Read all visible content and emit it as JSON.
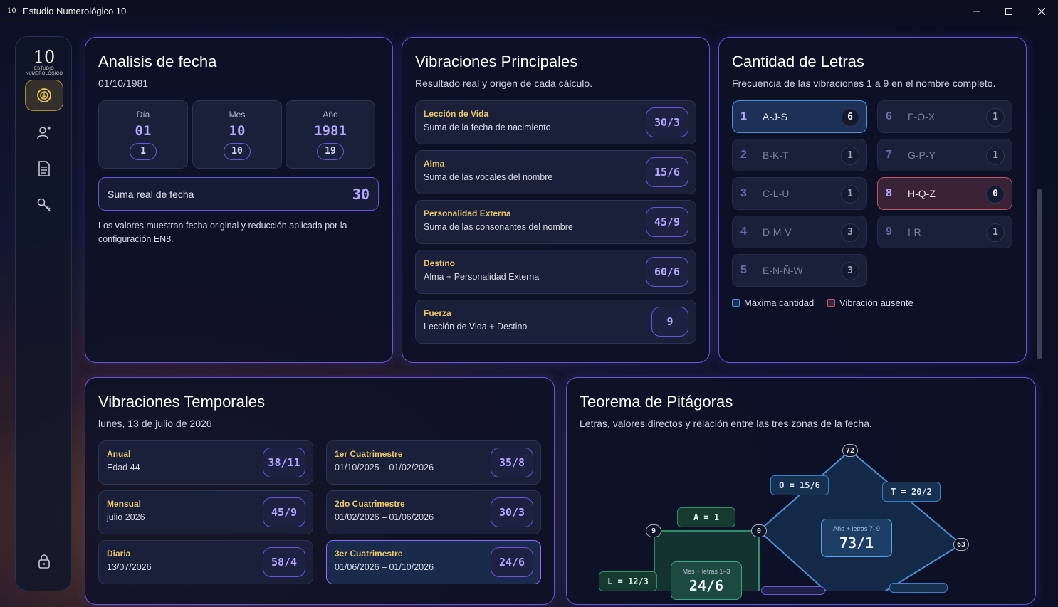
{
  "window": {
    "title": "Estudio Numerológico 10",
    "logo": "10",
    "controls": [
      "minimize-icon",
      "maximize-icon",
      "close-icon"
    ]
  },
  "sidebar": {
    "brand_num": "10",
    "brand_small": "ESTUDIO",
    "brand_sub": "NUMEROLÓGICO",
    "items": [
      {
        "icon": "numerology-icon",
        "active": true
      },
      {
        "icon": "person-sparkle-icon",
        "active": false
      },
      {
        "icon": "document-icon",
        "active": false
      },
      {
        "icon": "key-icon",
        "active": false
      }
    ],
    "lock_icon": "lock-icon"
  },
  "fecha": {
    "title": "Analisis de fecha",
    "date": "01/10/1981",
    "cells": [
      {
        "label": "Día",
        "value": "01",
        "reduced": "1"
      },
      {
        "label": "Mes",
        "value": "10",
        "reduced": "10"
      },
      {
        "label": "Año",
        "value": "1981",
        "reduced": "19"
      }
    ],
    "sum_label": "Suma real de fecha",
    "sum_value": "30",
    "note": "Los valores muestran fecha original y reducción aplicada por la configuración EN8."
  },
  "vibraciones": {
    "title": "Vibraciones Principales",
    "subtitle": "Resultado real y origen de cada cálculo.",
    "rows": [
      {
        "title": "Lección de Vida",
        "desc": "Suma de la fecha de nacimiento",
        "value": "30/3"
      },
      {
        "title": "Alma",
        "desc": "Suma de las vocales del nombre",
        "value": "15/6"
      },
      {
        "title": "Personalidad Externa",
        "desc": "Suma de las consonantes del nombre",
        "value": "45/9"
      },
      {
        "title": "Destino",
        "desc": "Alma + Personalidad Externa",
        "value": "60/6"
      },
      {
        "title": "Fuerza",
        "desc": "Lección de Vida + Destino",
        "value": "9"
      }
    ]
  },
  "letras": {
    "title": "Cantidad de Letras",
    "subtitle": "Frecuencia de las vibraciones 1 a 9 en el nombre completo.",
    "cells": [
      {
        "num": "1",
        "letters": "A-J-S",
        "count": "6",
        "state": "max"
      },
      {
        "num": "2",
        "letters": "B-K-T",
        "count": "1",
        "state": "normal"
      },
      {
        "num": "3",
        "letters": "C-L-U",
        "count": "1",
        "state": "normal"
      },
      {
        "num": "4",
        "letters": "D-M-V",
        "count": "3",
        "state": "normal"
      },
      {
        "num": "5",
        "letters": "E-N-Ñ-W",
        "count": "3",
        "state": "normal"
      },
      {
        "num": "6",
        "letters": "F-O-X",
        "count": "1",
        "state": "normal"
      },
      {
        "num": "7",
        "letters": "G-P-Y",
        "count": "1",
        "state": "normal"
      },
      {
        "num": "8",
        "letters": "H-Q-Z",
        "count": "0",
        "state": "absent"
      },
      {
        "num": "9",
        "letters": "I-R",
        "count": "1",
        "state": "normal"
      }
    ],
    "legend_max": "Máxima cantidad",
    "legend_absent": "Vibración ausente",
    "color_max": "#4f8fdc",
    "color_absent": "#c0566a"
  },
  "temporales": {
    "title": "Vibraciones Temporales",
    "subtitle": "lunes, 13 de julio de 2026",
    "rows": [
      {
        "title": "Anual",
        "desc": "Edad 44",
        "value": "38/11",
        "highlight": false
      },
      {
        "title": "Mensual",
        "desc": "julio 2026",
        "value": "45/9",
        "highlight": false
      },
      {
        "title": "Diaria",
        "desc": "13/07/2026",
        "value": "58/4",
        "highlight": false
      },
      {
        "title": "1er Cuatrimestre",
        "desc": "01/10/2025 – 01/02/2026",
        "value": "35/8",
        "highlight": false
      },
      {
        "title": "2do Cuatrimestre",
        "desc": "01/02/2026 – 01/06/2026",
        "value": "30/3",
        "highlight": false
      },
      {
        "title": "3er Cuatrimestre",
        "desc": "01/06/2026 – 01/10/2026",
        "value": "24/6",
        "highlight": true
      }
    ]
  },
  "pitagoras": {
    "title": "Teorema de Pitágoras",
    "subtitle": "Letras, valores directos y relación entre las tres zonas de la fecha.",
    "labels": {
      "o": "O = 15/6",
      "t": "T = 20/2",
      "a": "A = 1",
      "l": "L = 12/3"
    },
    "vertices": {
      "top": "72",
      "left": "0",
      "right": "63",
      "green_top": "9"
    },
    "year_box": {
      "label": "Año + letras 7–9",
      "value": "73/1"
    },
    "month_box": {
      "label": "Mes + letras 1–3",
      "value": "24/6"
    }
  }
}
